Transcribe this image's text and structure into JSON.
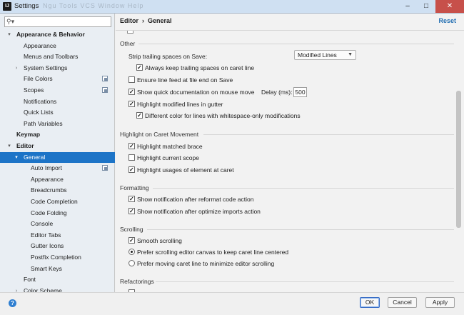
{
  "window": {
    "title": "Settings",
    "ghost_menu": "Ngu  Tools  VCS  Window  Help"
  },
  "search": {
    "placeholder": "",
    "value": ""
  },
  "sidebar": {
    "items": [
      {
        "label": "Appearance & Behavior",
        "level": 0,
        "arrow": "down",
        "bold": true,
        "icon": "none"
      },
      {
        "label": "Appearance",
        "level": 1,
        "arrow": "",
        "bold": false,
        "icon": "none"
      },
      {
        "label": "Menus and Toolbars",
        "level": 1,
        "arrow": "",
        "bold": false,
        "icon": "none"
      },
      {
        "label": "System Settings",
        "level": 1,
        "arrow": "right",
        "bold": false,
        "icon": "none"
      },
      {
        "label": "File Colors",
        "level": 1,
        "arrow": "",
        "bold": false,
        "icon": "copy-icon"
      },
      {
        "label": "Scopes",
        "level": 1,
        "arrow": "",
        "bold": false,
        "icon": "copy-icon"
      },
      {
        "label": "Notifications",
        "level": 1,
        "arrow": "",
        "bold": false,
        "icon": "none"
      },
      {
        "label": "Quick Lists",
        "level": 1,
        "arrow": "",
        "bold": false,
        "icon": "none"
      },
      {
        "label": "Path Variables",
        "level": 1,
        "arrow": "",
        "bold": false,
        "icon": "none"
      },
      {
        "label": "Keymap",
        "level": 0,
        "arrow": "",
        "bold": true,
        "icon": "none"
      },
      {
        "label": "Editor",
        "level": 0,
        "arrow": "down",
        "bold": true,
        "icon": "none"
      },
      {
        "label": "General",
        "level": 1,
        "arrow": "down",
        "bold": false,
        "icon": "none",
        "selected": true
      },
      {
        "label": "Auto Import",
        "level": 2,
        "arrow": "",
        "bold": false,
        "icon": "copy-icon"
      },
      {
        "label": "Appearance",
        "level": 2,
        "arrow": "",
        "bold": false,
        "icon": "none"
      },
      {
        "label": "Breadcrumbs",
        "level": 2,
        "arrow": "",
        "bold": false,
        "icon": "none"
      },
      {
        "label": "Code Completion",
        "level": 2,
        "arrow": "",
        "bold": false,
        "icon": "none"
      },
      {
        "label": "Code Folding",
        "level": 2,
        "arrow": "",
        "bold": false,
        "icon": "none"
      },
      {
        "label": "Console",
        "level": 2,
        "arrow": "",
        "bold": false,
        "icon": "none"
      },
      {
        "label": "Editor Tabs",
        "level": 2,
        "arrow": "",
        "bold": false,
        "icon": "none"
      },
      {
        "label": "Gutter Icons",
        "level": 2,
        "arrow": "",
        "bold": false,
        "icon": "none"
      },
      {
        "label": "Postfix Completion",
        "level": 2,
        "arrow": "",
        "bold": false,
        "icon": "none"
      },
      {
        "label": "Smart Keys",
        "level": 2,
        "arrow": "",
        "bold": false,
        "icon": "none"
      },
      {
        "label": "Font",
        "level": 1,
        "arrow": "",
        "bold": false,
        "icon": "none"
      },
      {
        "label": "Color Scheme",
        "level": 1,
        "arrow": "right",
        "bold": false,
        "icon": "none"
      }
    ]
  },
  "header": {
    "crumb_1": "Editor",
    "crumb_sep": "›",
    "crumb_2": "General",
    "reset": "Reset"
  },
  "other": {
    "section": "Other",
    "strip_label": "Strip trailing spaces on Save:",
    "strip_value": "Modified Lines",
    "keep_trailing": {
      "label": "Always keep trailing spaces on caret line",
      "checked": true
    },
    "ensure_line_feed": {
      "label": "Ensure line feed at file end on Save",
      "checked": false
    },
    "quick_doc": {
      "label": "Show quick documentation on mouse move",
      "checked": true
    },
    "delay_label": "Delay (ms):",
    "delay_value": "500",
    "highlight_modified": {
      "label": "Highlight modified lines in gutter",
      "checked": true
    },
    "different_color": {
      "label": "Different color for lines with whitespace-only modifications",
      "checked": true
    }
  },
  "caret_section": {
    "section": "Highlight on Caret Movement",
    "matched_brace": {
      "label": "Highlight matched brace",
      "checked": true
    },
    "current_scope": {
      "label": "Highlight current scope",
      "checked": false
    },
    "usages": {
      "label": "Highlight usages of element at caret",
      "checked": true
    }
  },
  "formatting": {
    "section": "Formatting",
    "after_reformat": {
      "label": "Show notification after reformat code action",
      "checked": true
    },
    "after_optimize": {
      "label": "Show notification after optimize imports action",
      "checked": true
    }
  },
  "scrolling": {
    "section": "Scrolling",
    "smooth": {
      "label": "Smooth scrolling",
      "checked": true
    },
    "prefer_canvas": {
      "label": "Prefer scrolling editor canvas to keep caret line centered",
      "selected": true
    },
    "prefer_caret": {
      "label": "Prefer moving caret line to minimize editor scrolling",
      "selected": false
    }
  },
  "refactorings": {
    "section": "Refactorings"
  },
  "buttons": {
    "ok": "OK",
    "cancel": "Cancel",
    "apply": "Apply",
    "help": "?"
  },
  "colors": {
    "selection": "#1d74c7",
    "link": "#2470b3",
    "close": "#c7504a"
  }
}
